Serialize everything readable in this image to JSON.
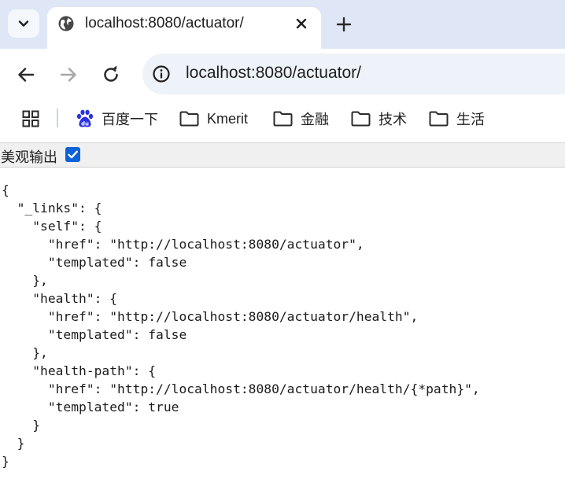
{
  "browser": {
    "tab": {
      "title": "localhost:8080/actuator/"
    },
    "omnibox": {
      "url": "localhost:8080/actuator/"
    },
    "bookmarks": [
      {
        "label": "百度一下",
        "icon": "baidu-icon"
      },
      {
        "label": "Kmerit",
        "icon": "folder-icon"
      },
      {
        "label": "金融",
        "icon": "folder-icon"
      },
      {
        "label": "技术",
        "icon": "folder-icon"
      },
      {
        "label": "生活",
        "icon": "folder-icon"
      }
    ]
  },
  "viewer": {
    "pretty_print_label": "美观输出",
    "pretty_print_checked": true
  },
  "json_lines": [
    "{",
    "  \"_links\": {",
    "    \"self\": {",
    "      \"href\": \"http://localhost:8080/actuator\",",
    "      \"templated\": false",
    "    },",
    "    \"health\": {",
    "      \"href\": \"http://localhost:8080/actuator/health\",",
    "      \"templated\": false",
    "    },",
    "    \"health-path\": {",
    "      \"href\": \"http://localhost:8080/actuator/health/{*path}\",",
    "      \"templated\": true",
    "    }",
    "  }",
    "}"
  ],
  "colors": {
    "tabstrip_bg": "#dfe7f6",
    "omnibox_bg": "#eef2f9",
    "checkbox_accent": "#0b62d6",
    "baidu_blue": "#2932e1"
  }
}
